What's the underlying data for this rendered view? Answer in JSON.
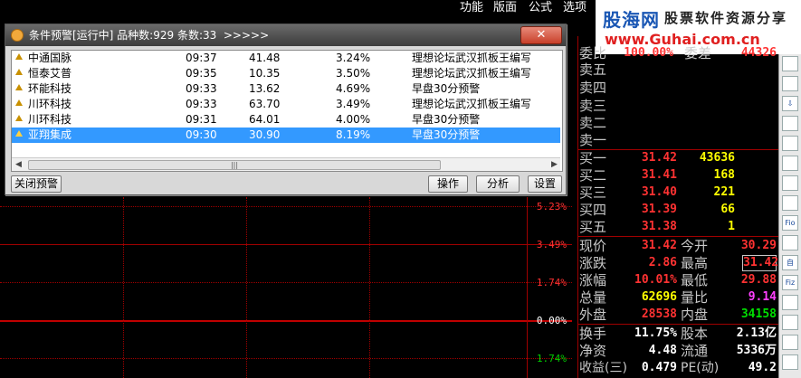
{
  "menubar": {
    "items": [
      "功能",
      "版面",
      "公式",
      "选项"
    ]
  },
  "logo": {
    "title": "股海网",
    "subtitle": "股票软件资源分享",
    "url": "www.Guhai.com.cn"
  },
  "dialog": {
    "title": "条件预警[运行中] 品种数:929 条数:33  >>>>>",
    "close_label": "✕",
    "rows": [
      {
        "name": "中通国脉",
        "time": "09:37",
        "price": "41.48",
        "pct": "3.24%",
        "desc": "理想论坛武汉抓板王编写"
      },
      {
        "name": "恒泰艾普",
        "time": "09:35",
        "price": "10.35",
        "pct": "3.50%",
        "desc": "理想论坛武汉抓板王编写"
      },
      {
        "name": "环能科技",
        "time": "09:33",
        "price": "13.62",
        "pct": "4.69%",
        "desc": "早盘30分预警"
      },
      {
        "name": "川环科技",
        "time": "09:33",
        "price": "63.70",
        "pct": "3.49%",
        "desc": "理想论坛武汉抓板王编写"
      },
      {
        "name": "川环科技",
        "time": "09:31",
        "price": "64.01",
        "pct": "4.00%",
        "desc": "早盘30分预警"
      },
      {
        "name": "亚翔集成",
        "time": "09:30",
        "price": "30.90",
        "pct": "8.19%",
        "desc": "早盘30分预警"
      }
    ],
    "scroll_thumb": "|||",
    "close_alert_label": "关闭预警",
    "operate_label": "操作",
    "analyze_label": "分析",
    "settings_label": "设置"
  },
  "chart": {
    "pct_labels": [
      "5.23%",
      "3.49%",
      "1.74%",
      "0.00%",
      "1.74%"
    ]
  },
  "quote": {
    "weibi_label": "委比",
    "weibi_value": "100.00%",
    "weicha_label": "委差",
    "weicha_value": "44326",
    "sell_labels": [
      "卖五",
      "卖四",
      "卖三",
      "卖二",
      "卖一"
    ],
    "buy": [
      {
        "label": "买一",
        "price": "31.42",
        "vol": "43636"
      },
      {
        "label": "买二",
        "price": "31.41",
        "vol": "168"
      },
      {
        "label": "买三",
        "price": "31.40",
        "vol": "221"
      },
      {
        "label": "买四",
        "price": "31.39",
        "vol": "66"
      },
      {
        "label": "买五",
        "price": "31.38",
        "vol": "1"
      }
    ],
    "stats": [
      {
        "l1": "现价",
        "v1": "31.42",
        "l2": "今开",
        "v2": "30.29"
      },
      {
        "l1": "涨跌",
        "v1": "2.86",
        "l2": "最高",
        "v2": "31.42"
      },
      {
        "l1": "涨幅",
        "v1": "10.01%",
        "l2": "最低",
        "v2": "29.88"
      },
      {
        "l1": "总量",
        "v1": "62696",
        "l2": "量比",
        "v2": "9.14"
      },
      {
        "l1": "外盘",
        "v1": "28538",
        "l2": "内盘",
        "v2": "34158"
      }
    ],
    "info": [
      {
        "l1": "换手",
        "v1": "11.75%",
        "l2": "股本",
        "v2": "2.13亿"
      },
      {
        "l1": "净资",
        "v1": "4.48",
        "l2": "流通",
        "v2": "5336万"
      },
      {
        "l1": "收益(三)",
        "v1": "0.479",
        "l2": "PE(动)",
        "v2": "49.2"
      }
    ]
  },
  "toolbar": {
    "icons": [
      "list-icon",
      "grid-icon",
      "down-arrow-icon",
      "chart-icon",
      "text-icon",
      "trend-icon",
      "candle-icon",
      "line-icon",
      "fio-icon",
      "bar-icon",
      "self-icon",
      "fiz-icon",
      "circle-chart-icon",
      "wave-icon",
      "wave2-icon",
      "wave3-icon"
    ],
    "labels": [
      "",
      "",
      "⇩",
      "",
      "",
      "",
      "",
      "",
      "Fio",
      "",
      "自",
      "Fiz",
      "",
      "",
      "",
      ""
    ]
  }
}
